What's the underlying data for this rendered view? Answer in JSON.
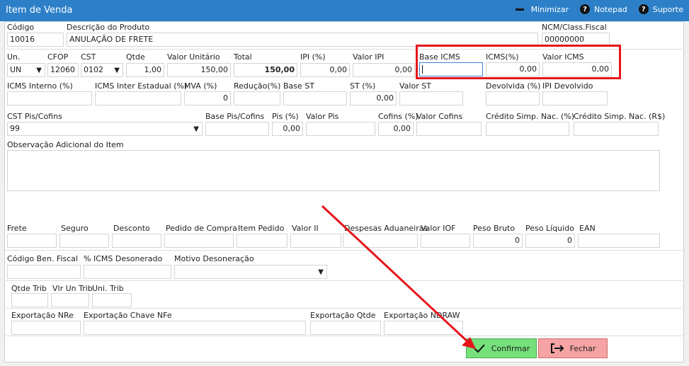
{
  "window": {
    "title": "Item de Venda",
    "minimize_label": "Minimizar",
    "notepad_label": "Notepad",
    "support_label": "Suporte",
    "help_glyph": "?"
  },
  "fields": {
    "codigo": {
      "label": "Código",
      "value": "10016"
    },
    "descricao": {
      "label": "Descrição do Produto",
      "value": "ANULAÇÃO DE FRETE"
    },
    "ncm": {
      "label": "NCM/Class.Fiscal",
      "value": "00000000"
    },
    "un": {
      "label": "Un.",
      "value": "UN"
    },
    "cfop": {
      "label": "CFOP",
      "value": "12060"
    },
    "cst": {
      "label": "CST",
      "value": "0102"
    },
    "qtde": {
      "label": "Qtde",
      "value": "1,00"
    },
    "valor_unitario": {
      "label": "Valor Unitário",
      "value": "150,00"
    },
    "total": {
      "label": "Total",
      "value": "150,00"
    },
    "ipi_pct": {
      "label": "IPI (%)",
      "value": "0,00"
    },
    "valor_ipi": {
      "label": "Valor IPI",
      "value": "0,00"
    },
    "base_icms": {
      "label": "Base ICMS",
      "value": ""
    },
    "icms_pct": {
      "label": "ICMS(%)",
      "value": "0,00"
    },
    "valor_icms": {
      "label": "Valor ICMS",
      "value": "0,00"
    },
    "icms_interno": {
      "label": "ICMS Interno (%)",
      "value": ""
    },
    "icms_inter_estadual": {
      "label": "ICMS Inter Estadual (%)",
      "value": ""
    },
    "mva": {
      "label": "MVA (%)",
      "value": "0"
    },
    "reducao": {
      "label": "Redução(%)",
      "value": ""
    },
    "base_st": {
      "label": "Base ST",
      "value": ""
    },
    "st_pct": {
      "label": "ST (%)",
      "value": "0,00"
    },
    "valor_st": {
      "label": "Valor ST",
      "value": ""
    },
    "devolvida": {
      "label": "Devolvida (%)",
      "value": ""
    },
    "ipi_devolvido": {
      "label": "IPI Devolvido",
      "value": ""
    },
    "cst_pis_cofins": {
      "label": "CST Pis/Cofins",
      "value": "99"
    },
    "base_pis_cofins": {
      "label": "Base Pis/Cofins",
      "value": ""
    },
    "pis_pct": {
      "label": "Pis (%)",
      "value": "0,00"
    },
    "valor_pis": {
      "label": "Valor Pis",
      "value": ""
    },
    "cofins_pct": {
      "label": "Cofins (%)",
      "value": "0,00"
    },
    "valor_cofins": {
      "label": "Valor Cofins",
      "value": ""
    },
    "credito_simp_pct": {
      "label": "Crédito Simp. Nac. (%)",
      "value": ""
    },
    "credito_simp_rs": {
      "label": "Crédito Simp. Nac. (R$)",
      "value": ""
    },
    "observacao": {
      "label": "Observação Adicional do Item",
      "value": ""
    },
    "frete": {
      "label": "Frete",
      "value": ""
    },
    "seguro": {
      "label": "Seguro",
      "value": ""
    },
    "desconto": {
      "label": "Desconto",
      "value": ""
    },
    "pedido_compra": {
      "label": "Pedido de Compra",
      "value": ""
    },
    "item_pedido": {
      "label": "Item Pedido",
      "value": ""
    },
    "valor_ii": {
      "label": "Valor II",
      "value": ""
    },
    "despesas_aduaneiras": {
      "label": "Despesas Aduaneiras",
      "value": ""
    },
    "valor_iof": {
      "label": "Valor IOF",
      "value": ""
    },
    "peso_bruto": {
      "label": "Peso Bruto",
      "value": "0"
    },
    "peso_liquido": {
      "label": "Peso Líquido",
      "value": "0"
    },
    "ean": {
      "label": "EAN",
      "value": ""
    },
    "codigo_ben_fiscal": {
      "label": "Código Ben. Fiscal",
      "value": ""
    },
    "icms_desonerado": {
      "label": "% ICMS Desonerado",
      "value": ""
    },
    "motivo_desoneracao": {
      "label": "Motivo Desoneração",
      "value": ""
    },
    "qtde_trib": {
      "label": "Qtde Trib",
      "value": ""
    },
    "vlr_un_trib": {
      "label": "Vlr Un Trib",
      "value": ""
    },
    "uni_trib": {
      "label": "Uni. Trib",
      "value": ""
    },
    "exportacao_nre": {
      "label": "Exportação NRe",
      "value": ""
    },
    "exportacao_chave": {
      "label": "Exportação Chave NFe",
      "value": ""
    },
    "exportacao_qtde": {
      "label": "Exportação Qtde",
      "value": ""
    },
    "exportacao_ndraw": {
      "label": "Exportação NDRAW",
      "value": ""
    }
  },
  "buttons": {
    "confirmar": "Confirmar",
    "fechar": "Fechar"
  },
  "colors": {
    "titlebar": "#2d80c8",
    "highlight_box": "#e5141b",
    "confirm_bg": "#76e07b",
    "close_bg": "#f6a3a3"
  }
}
